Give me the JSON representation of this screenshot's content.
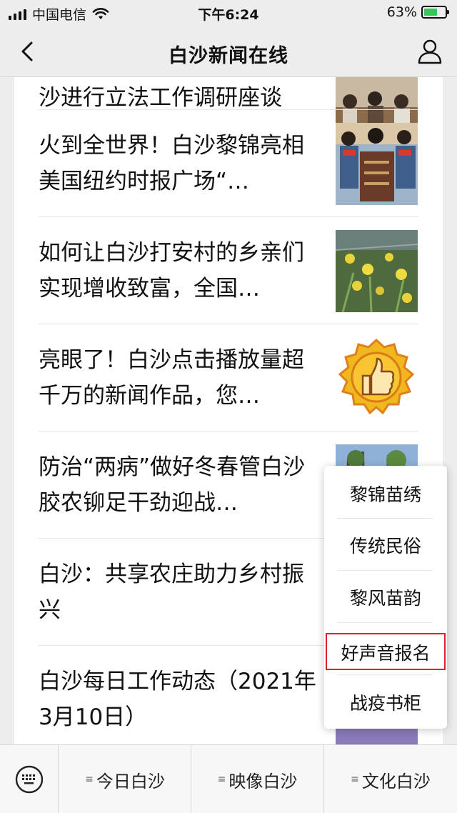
{
  "status_bar": {
    "carrier": "中国电信",
    "time": "下午6:24",
    "battery_percent": "63%",
    "battery_level": 0.63
  },
  "nav": {
    "title": "白沙新闻在线",
    "back_icon": "chevron-left-icon",
    "user_icon": "person-icon"
  },
  "articles": [
    {
      "title": "沙进行立法工作调研座谈",
      "thumb": "meeting-photo"
    },
    {
      "title": "火到全世界！白沙黎锦亮相美国纽约时报广场“…",
      "thumb": "embroidery-photo"
    },
    {
      "title": "如何让白沙打安村的乡亲们实现增收致富，全国…",
      "thumb": "flower-field-photo"
    },
    {
      "title": "亮眼了！白沙点击播放量超千万的新闻作品，您…",
      "thumb": "thumbs-up-badge"
    },
    {
      "title": "防治“两病”做好冬春管白沙胶农铆足干劲迎战…",
      "thumb": "rubber-trees-photo"
    },
    {
      "title": "白沙：共享农庄助力乡村振兴",
      "thumb": ""
    },
    {
      "title": "白沙每日工作动态（2021年3月10日）",
      "thumb": ""
    }
  ],
  "popup_menu": {
    "items": [
      "黎锦苗绣",
      "传统民俗",
      "黎风苗韵",
      "好声音报名",
      "战疫书柜"
    ],
    "highlighted_index": 3,
    "highlight_color": "#e02020"
  },
  "menu_bar": {
    "keyboard_icon": "keyboard-icon",
    "tabs": [
      "今日白沙",
      "映像白沙",
      "文化白沙"
    ],
    "tab_icon": "≡"
  },
  "colors": {
    "background": "#ededed",
    "battery_fill": "#34c759"
  }
}
